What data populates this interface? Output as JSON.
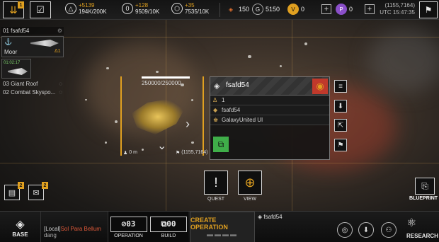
{
  "top_bar": {
    "notification_count": "1",
    "res1": {
      "rate": "+5139",
      "amount": "194K/200K"
    },
    "res2": {
      "rate": "+128",
      "amount": "9509/10K"
    },
    "res3": {
      "rate": "+35",
      "amount": "7535/10K"
    },
    "fuel": "150",
    "credits": "5150",
    "currency_v": "0",
    "currency_p": "0",
    "plus": "+",
    "coords": "(1155,7164)",
    "utc_time": "UTC 15:47:35"
  },
  "left_panel": {
    "fleet_header": "01 fsafd54",
    "fleet_status": "Moor",
    "fleet_warn": "Δ1",
    "ship_label": "01:02:17",
    "items": [
      {
        "label": "03 Giant Roof"
      },
      {
        "label": "02 Combat Skyspo..."
      }
    ]
  },
  "target": {
    "hp": "250000/250000",
    "distance": "0 m",
    "coords": "(1155,7164)"
  },
  "info_card": {
    "name": "fsafd54",
    "level": "1",
    "owner": "fsafd54",
    "alliance": "GalaxyUnited UI"
  },
  "actions": {
    "quest_label": "QUEST",
    "view_label": "VIEW"
  },
  "side_badges": {
    "mail_badge": "2",
    "tasks_badge": "2"
  },
  "blueprint_label": "BLUEPRINT",
  "bottom_bar": {
    "base_label": "BASE",
    "chat_channel": "[Local]",
    "chat_name": "Sol Para Bellum",
    "chat_text": "dang",
    "operation_count": "03",
    "operation_label": "OPERATION",
    "build_count": "00",
    "build_label": "BUILD",
    "create_operation": "CREATE OPERATION",
    "selected_fleet": "fsafd54",
    "research_label": "RESEARCH"
  },
  "colors": {
    "accent": "#e0a020",
    "danger": "#c0392b",
    "ally_green": "#3fae49"
  }
}
